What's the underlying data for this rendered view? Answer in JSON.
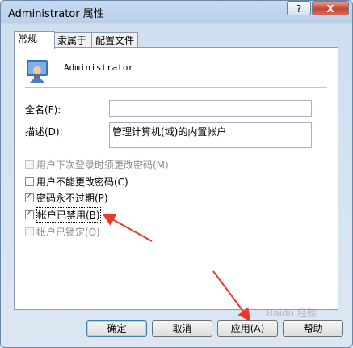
{
  "window": {
    "title": "Administrator 属性",
    "help_label": "?",
    "close_label": "X"
  },
  "tabs": [
    {
      "label": "常规"
    },
    {
      "label": "隶属于"
    },
    {
      "label": "配置文件"
    }
  ],
  "user": {
    "name": "Administrator"
  },
  "fields": {
    "fullname_label": "全名(F):",
    "fullname_value": "",
    "description_label": "描述(D):",
    "description_value": "管理计算机(域)的内置帐户"
  },
  "checkboxes": [
    {
      "label": "用户下次登录时须更改密码(M)",
      "checked": false,
      "enabled": false
    },
    {
      "label": "用户不能更改密码(C)",
      "checked": false,
      "enabled": true
    },
    {
      "label": "密码永不过期(P)",
      "checked": true,
      "enabled": true
    },
    {
      "label": "帐户已禁用(B)",
      "checked": true,
      "enabled": true
    },
    {
      "label": "帐户已锁定(O)",
      "checked": false,
      "enabled": false
    }
  ],
  "buttons": {
    "ok": "确定",
    "cancel": "取消",
    "apply": "应用(A)",
    "help": "帮助"
  },
  "annotation": {
    "color": "#e8392b"
  },
  "watermark": "Baidu 经验"
}
